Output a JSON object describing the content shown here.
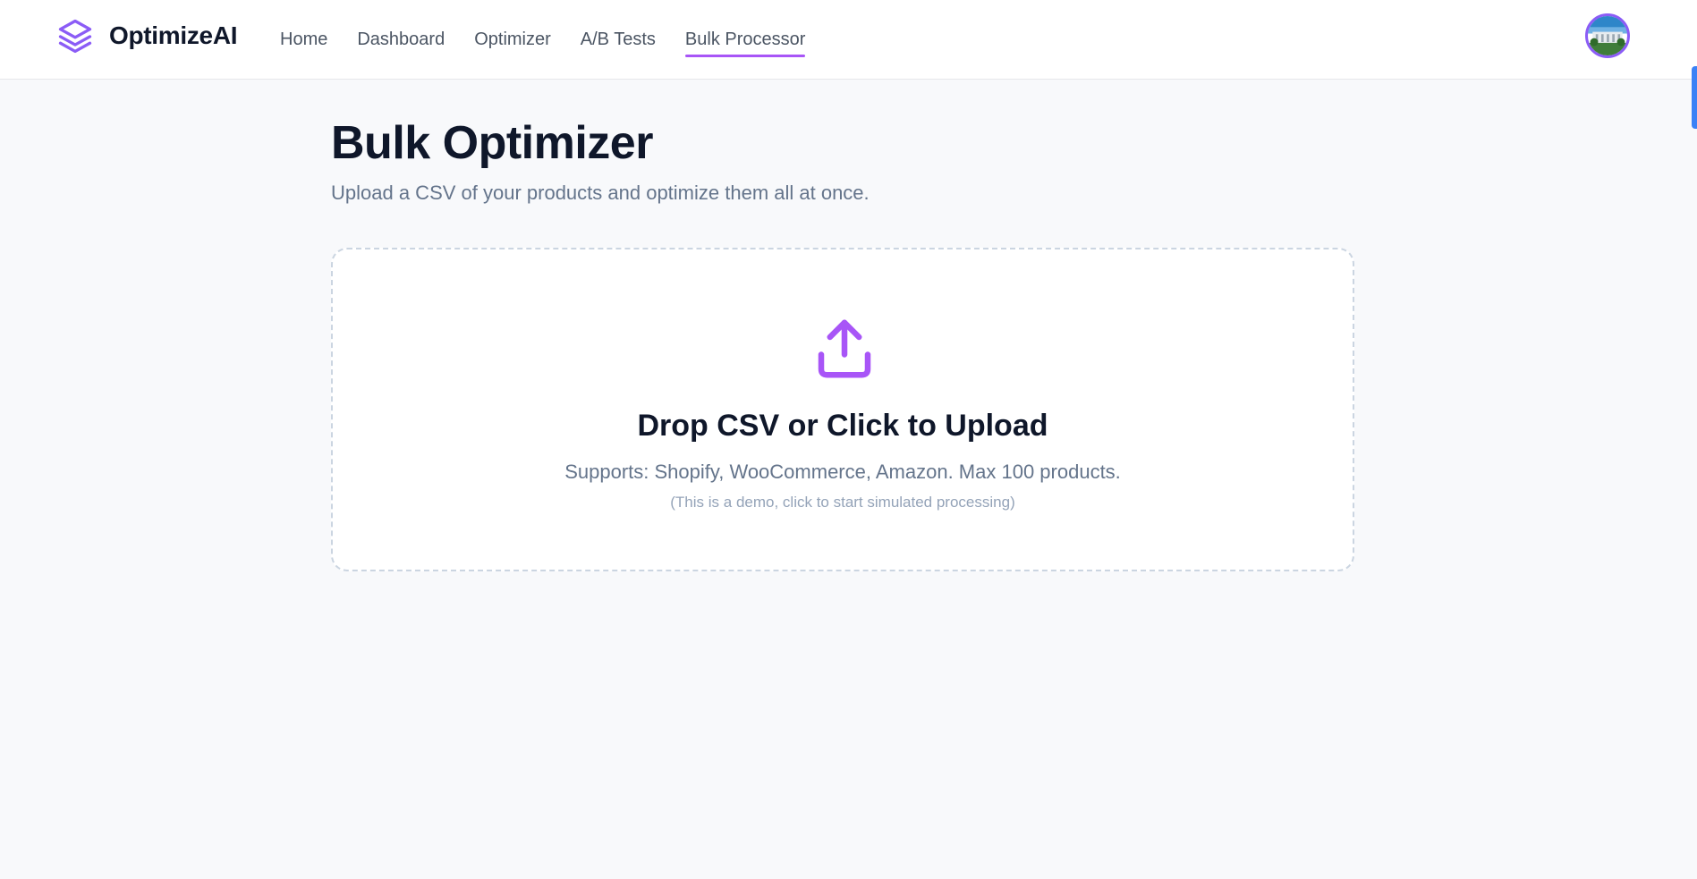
{
  "brand": {
    "name": "OptimizeAI",
    "icon": "layers-icon",
    "color": "#8b5cf6"
  },
  "nav": {
    "items": [
      {
        "label": "Home",
        "active": false
      },
      {
        "label": "Dashboard",
        "active": false
      },
      {
        "label": "Optimizer",
        "active": false
      },
      {
        "label": "A/B Tests",
        "active": false
      },
      {
        "label": "Bulk Processor",
        "active": true
      }
    ],
    "active_color": "#a855f7"
  },
  "user": {
    "avatar": "user-avatar"
  },
  "main": {
    "title": "Bulk Optimizer",
    "subtitle": "Upload a CSV of your products and optimize them all at once."
  },
  "dropzone": {
    "icon": "upload-icon",
    "title": "Drop CSV or Click to Upload",
    "supports": "Supports: Shopify, WooCommerce, Amazon. Max 100 products.",
    "note": "(This is a demo, click to start simulated processing)",
    "accent": "#a855f7"
  }
}
